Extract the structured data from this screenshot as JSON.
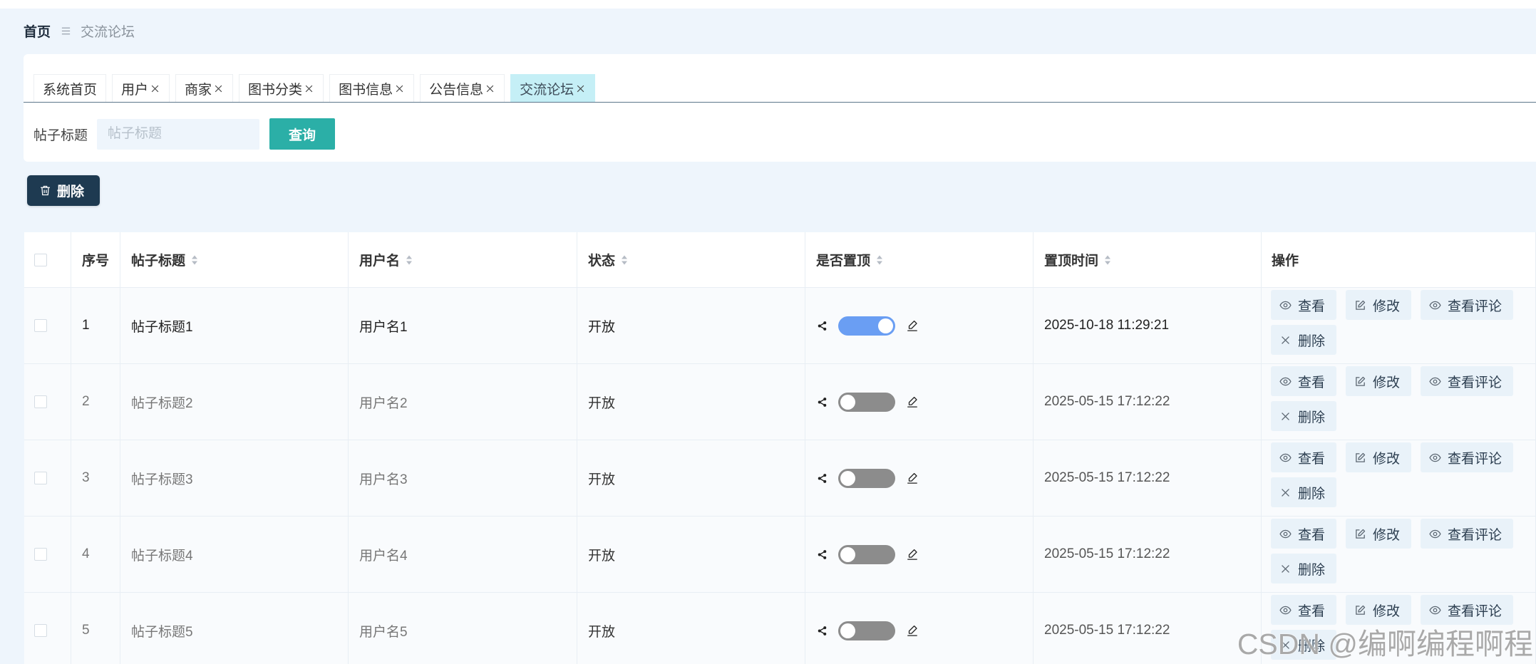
{
  "breadcrumb": {
    "home": "首页",
    "separator_icon": "menu-icon",
    "current": "交流论坛"
  },
  "tabs": [
    {
      "label": "系统首页",
      "closable": false,
      "active": false
    },
    {
      "label": "用户",
      "closable": true,
      "active": false
    },
    {
      "label": "商家",
      "closable": true,
      "active": false
    },
    {
      "label": "图书分类",
      "closable": true,
      "active": false
    },
    {
      "label": "图书信息",
      "closable": true,
      "active": false
    },
    {
      "label": "公告信息",
      "closable": true,
      "active": false
    },
    {
      "label": "交流论坛",
      "closable": true,
      "active": true
    }
  ],
  "search": {
    "label": "帖子标题",
    "placeholder": "帖子标题",
    "button_label": "查询"
  },
  "toolbar": {
    "delete_label": "删除",
    "delete_icon": "trash-icon"
  },
  "table": {
    "columns": {
      "seq": "序号",
      "title": "帖子标题",
      "user": "用户名",
      "status": "状态",
      "pinned": "是否置顶",
      "pin_time": "置顶时间",
      "actions": "操作"
    },
    "rows": [
      {
        "seq": "1",
        "title": "帖子标题1",
        "user": "用户名1",
        "status": "开放",
        "pinned": true,
        "pin_time": "2025-10-18 11:29:21"
      },
      {
        "seq": "2",
        "title": "帖子标题2",
        "user": "用户名2",
        "status": "开放",
        "pinned": false,
        "pin_time": "2025-05-15 17:12:22"
      },
      {
        "seq": "3",
        "title": "帖子标题3",
        "user": "用户名3",
        "status": "开放",
        "pinned": false,
        "pin_time": "2025-05-15 17:12:22"
      },
      {
        "seq": "4",
        "title": "帖子标题4",
        "user": "用户名4",
        "status": "开放",
        "pinned": false,
        "pin_time": "2025-05-15 17:12:22"
      },
      {
        "seq": "5",
        "title": "帖子标题5",
        "user": "用户名5",
        "status": "开放",
        "pinned": false,
        "pin_time": "2025-05-15 17:12:22"
      }
    ]
  },
  "actions": {
    "view": "查看",
    "edit": "修改",
    "view_comments": "查看评论",
    "delete": "删除",
    "icons": {
      "view": "eye-icon",
      "edit": "edit-icon",
      "view_comments": "eye-icon",
      "delete": "close-icon"
    }
  },
  "watermark": "CSDN @编啊编程啊程",
  "colors": {
    "background": "#eef5fc",
    "search_button": "#2bafa7",
    "delete_button": "#1e3a51",
    "active_tab": "#c5eff6",
    "toggle_on": "#6a9ef3",
    "toggle_off": "#8c8c8c"
  }
}
